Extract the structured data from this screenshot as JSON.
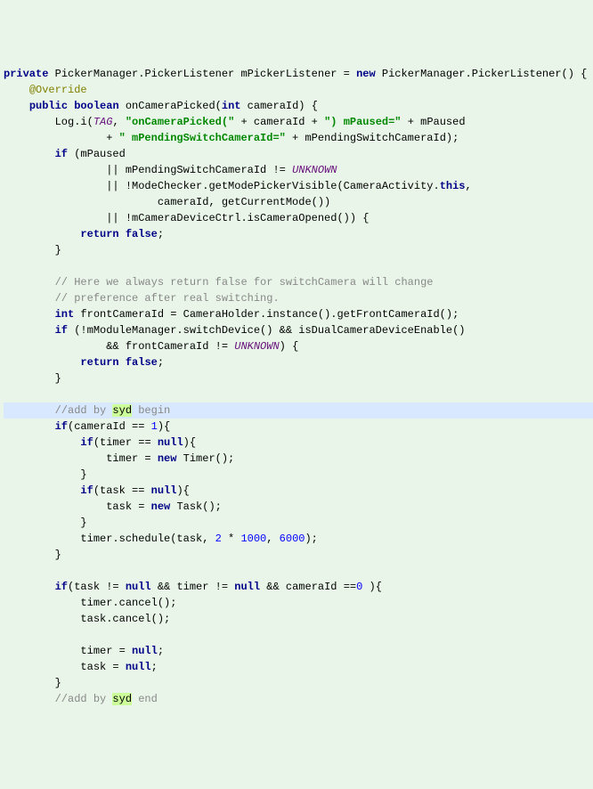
{
  "code": {
    "lines": [
      {
        "hl": false,
        "segs": [
          {
            "t": "private",
            "c": "kw"
          },
          {
            "t": " PickerManager.PickerListener mPickerListener = ",
            "c": "plain"
          },
          {
            "t": "new",
            "c": "kw"
          },
          {
            "t": " PickerManager.PickerListener() {",
            "c": "plain"
          }
        ]
      },
      {
        "hl": false,
        "segs": [
          {
            "t": "    ",
            "c": "plain"
          },
          {
            "t": "@Override",
            "c": "anno"
          }
        ]
      },
      {
        "hl": false,
        "segs": [
          {
            "t": "    ",
            "c": "plain"
          },
          {
            "t": "public",
            "c": "kw"
          },
          {
            "t": " ",
            "c": "plain"
          },
          {
            "t": "boolean",
            "c": "kw"
          },
          {
            "t": " onCameraPicked(",
            "c": "plain"
          },
          {
            "t": "int",
            "c": "kw"
          },
          {
            "t": " cameraId) {",
            "c": "plain"
          }
        ]
      },
      {
        "hl": false,
        "segs": [
          {
            "t": "        Log.i(",
            "c": "plain"
          },
          {
            "t": "TAG",
            "c": "const"
          },
          {
            "t": ", ",
            "c": "plain"
          },
          {
            "t": "\"onCameraPicked(\"",
            "c": "str"
          },
          {
            "t": " + cameraId + ",
            "c": "plain"
          },
          {
            "t": "\") mPaused=\"",
            "c": "str"
          },
          {
            "t": " + mPaused",
            "c": "plain"
          }
        ]
      },
      {
        "hl": false,
        "segs": [
          {
            "t": "                + ",
            "c": "plain"
          },
          {
            "t": "\" mPendingSwitchCameraId=\"",
            "c": "str"
          },
          {
            "t": " + mPendingSwitchCameraId);",
            "c": "plain"
          }
        ]
      },
      {
        "hl": false,
        "segs": [
          {
            "t": "        ",
            "c": "plain"
          },
          {
            "t": "if",
            "c": "kw"
          },
          {
            "t": " (mPaused",
            "c": "plain"
          }
        ]
      },
      {
        "hl": false,
        "segs": [
          {
            "t": "                || mPendingSwitchCameraId != ",
            "c": "plain"
          },
          {
            "t": "UNKNOWN",
            "c": "const"
          }
        ]
      },
      {
        "hl": false,
        "segs": [
          {
            "t": "                || !ModeChecker.getModePickerVisible(CameraActivity.",
            "c": "plain"
          },
          {
            "t": "this",
            "c": "kw"
          },
          {
            "t": ",",
            "c": "plain"
          }
        ]
      },
      {
        "hl": false,
        "segs": [
          {
            "t": "                        cameraId, getCurrentMode())",
            "c": "plain"
          }
        ]
      },
      {
        "hl": false,
        "segs": [
          {
            "t": "                || !mCameraDeviceCtrl.isCameraOpened()) {",
            "c": "plain"
          }
        ]
      },
      {
        "hl": false,
        "segs": [
          {
            "t": "            ",
            "c": "plain"
          },
          {
            "t": "return",
            "c": "kw"
          },
          {
            "t": " ",
            "c": "plain"
          },
          {
            "t": "false",
            "c": "kw"
          },
          {
            "t": ";",
            "c": "plain"
          }
        ]
      },
      {
        "hl": false,
        "segs": [
          {
            "t": "        }",
            "c": "plain"
          }
        ]
      },
      {
        "hl": false,
        "segs": [
          {
            "t": "",
            "c": "plain"
          }
        ]
      },
      {
        "hl": false,
        "segs": [
          {
            "t": "        ",
            "c": "plain"
          },
          {
            "t": "// Here we always return false for switchCamera will change",
            "c": "comment"
          }
        ]
      },
      {
        "hl": false,
        "segs": [
          {
            "t": "        ",
            "c": "plain"
          },
          {
            "t": "// preference after real switching.",
            "c": "comment"
          }
        ]
      },
      {
        "hl": false,
        "segs": [
          {
            "t": "        ",
            "c": "plain"
          },
          {
            "t": "int",
            "c": "kw"
          },
          {
            "t": " frontCameraId = CameraHolder.instance().getFrontCameraId();",
            "c": "plain"
          }
        ]
      },
      {
        "hl": false,
        "segs": [
          {
            "t": "        ",
            "c": "plain"
          },
          {
            "t": "if",
            "c": "kw"
          },
          {
            "t": " (!mModuleManager.switchDevice() && isDualCameraDeviceEnable()",
            "c": "plain"
          }
        ]
      },
      {
        "hl": false,
        "segs": [
          {
            "t": "                && frontCameraId != ",
            "c": "plain"
          },
          {
            "t": "UNKNOWN",
            "c": "const"
          },
          {
            "t": ") {",
            "c": "plain"
          }
        ]
      },
      {
        "hl": false,
        "segs": [
          {
            "t": "            ",
            "c": "plain"
          },
          {
            "t": "return",
            "c": "kw"
          },
          {
            "t": " ",
            "c": "plain"
          },
          {
            "t": "false",
            "c": "kw"
          },
          {
            "t": ";",
            "c": "plain"
          }
        ]
      },
      {
        "hl": false,
        "segs": [
          {
            "t": "        }",
            "c": "plain"
          }
        ]
      },
      {
        "hl": false,
        "segs": [
          {
            "t": "",
            "c": "plain"
          }
        ]
      },
      {
        "hl": true,
        "segs": [
          {
            "t": "        ",
            "c": "plain"
          },
          {
            "t": "//add by ",
            "c": "comment"
          },
          {
            "t": "syd",
            "c": "mark"
          },
          {
            "t": " begin",
            "c": "comment"
          }
        ]
      },
      {
        "hl": false,
        "segs": [
          {
            "t": "        ",
            "c": "plain"
          },
          {
            "t": "if",
            "c": "kw"
          },
          {
            "t": "(cameraId == ",
            "c": "plain"
          },
          {
            "t": "1",
            "c": "num"
          },
          {
            "t": "){",
            "c": "plain"
          }
        ]
      },
      {
        "hl": false,
        "segs": [
          {
            "t": "            ",
            "c": "plain"
          },
          {
            "t": "if",
            "c": "kw"
          },
          {
            "t": "(timer == ",
            "c": "plain"
          },
          {
            "t": "null",
            "c": "kw"
          },
          {
            "t": "){",
            "c": "plain"
          }
        ]
      },
      {
        "hl": false,
        "segs": [
          {
            "t": "                timer = ",
            "c": "plain"
          },
          {
            "t": "new",
            "c": "kw"
          },
          {
            "t": " Timer();",
            "c": "plain"
          }
        ]
      },
      {
        "hl": false,
        "segs": [
          {
            "t": "            }",
            "c": "plain"
          }
        ]
      },
      {
        "hl": false,
        "segs": [
          {
            "t": "            ",
            "c": "plain"
          },
          {
            "t": "if",
            "c": "kw"
          },
          {
            "t": "(task == ",
            "c": "plain"
          },
          {
            "t": "null",
            "c": "kw"
          },
          {
            "t": "){",
            "c": "plain"
          }
        ]
      },
      {
        "hl": false,
        "segs": [
          {
            "t": "                task = ",
            "c": "plain"
          },
          {
            "t": "new",
            "c": "kw"
          },
          {
            "t": " Task();",
            "c": "plain"
          }
        ]
      },
      {
        "hl": false,
        "segs": [
          {
            "t": "            }",
            "c": "plain"
          }
        ]
      },
      {
        "hl": false,
        "segs": [
          {
            "t": "            timer.schedule(task, ",
            "c": "plain"
          },
          {
            "t": "2",
            "c": "num"
          },
          {
            "t": " * ",
            "c": "plain"
          },
          {
            "t": "1000",
            "c": "num"
          },
          {
            "t": ", ",
            "c": "plain"
          },
          {
            "t": "6000",
            "c": "num"
          },
          {
            "t": ");",
            "c": "plain"
          }
        ]
      },
      {
        "hl": false,
        "segs": [
          {
            "t": "        }",
            "c": "plain"
          }
        ]
      },
      {
        "hl": false,
        "segs": [
          {
            "t": "",
            "c": "plain"
          }
        ]
      },
      {
        "hl": false,
        "segs": [
          {
            "t": "        ",
            "c": "plain"
          },
          {
            "t": "if",
            "c": "kw"
          },
          {
            "t": "(task != ",
            "c": "plain"
          },
          {
            "t": "null",
            "c": "kw"
          },
          {
            "t": " && timer != ",
            "c": "plain"
          },
          {
            "t": "null",
            "c": "kw"
          },
          {
            "t": " && cameraId ==",
            "c": "plain"
          },
          {
            "t": "0",
            "c": "num"
          },
          {
            "t": " ){",
            "c": "plain"
          }
        ]
      },
      {
        "hl": false,
        "segs": [
          {
            "t": "            timer.cancel();",
            "c": "plain"
          }
        ]
      },
      {
        "hl": false,
        "segs": [
          {
            "t": "            task.cancel();",
            "c": "plain"
          }
        ]
      },
      {
        "hl": false,
        "segs": [
          {
            "t": "",
            "c": "plain"
          }
        ]
      },
      {
        "hl": false,
        "segs": [
          {
            "t": "            timer = ",
            "c": "plain"
          },
          {
            "t": "null",
            "c": "kw"
          },
          {
            "t": ";",
            "c": "plain"
          }
        ]
      },
      {
        "hl": false,
        "segs": [
          {
            "t": "            task = ",
            "c": "plain"
          },
          {
            "t": "null",
            "c": "kw"
          },
          {
            "t": ";",
            "c": "plain"
          }
        ]
      },
      {
        "hl": false,
        "segs": [
          {
            "t": "        }",
            "c": "plain"
          }
        ]
      },
      {
        "hl": false,
        "segs": [
          {
            "t": "        ",
            "c": "plain"
          },
          {
            "t": "//add by ",
            "c": "comment"
          },
          {
            "t": "syd",
            "c": "mark"
          },
          {
            "t": " end",
            "c": "comment"
          }
        ]
      }
    ]
  }
}
